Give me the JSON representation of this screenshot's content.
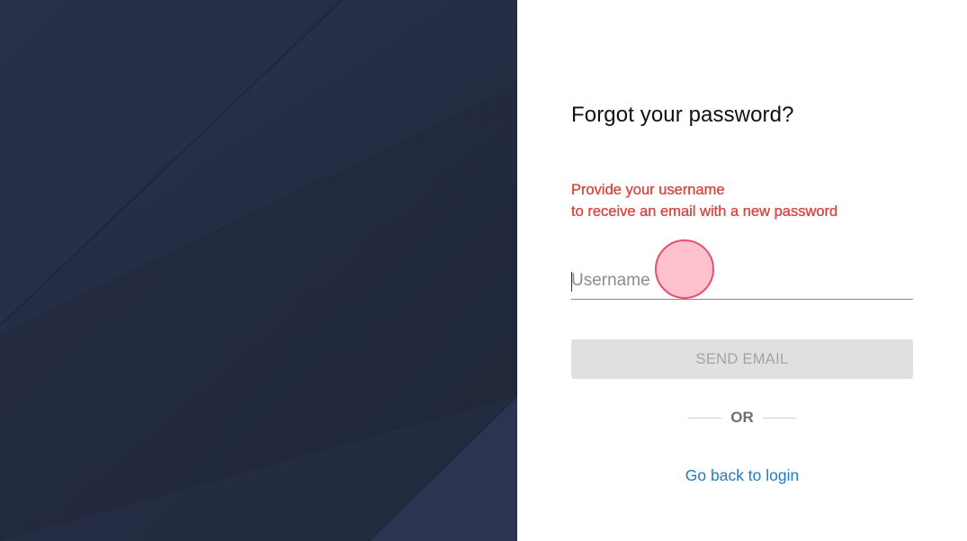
{
  "form": {
    "title": "Forgot your password?",
    "notice_line1": "Provide your username",
    "notice_line2": "to receive an email with a new password",
    "username_placeholder": "Username",
    "username_value": "",
    "send_label": "SEND EMAIL",
    "divider_label": "OR",
    "back_link_label": "Go back to login"
  },
  "colors": {
    "left_panel_bg": "#262f45",
    "notice": "#d9473f",
    "button_disabled_bg": "#e0e0e0",
    "button_disabled_text": "#a3a3a3",
    "link": "#1f7cc4"
  }
}
